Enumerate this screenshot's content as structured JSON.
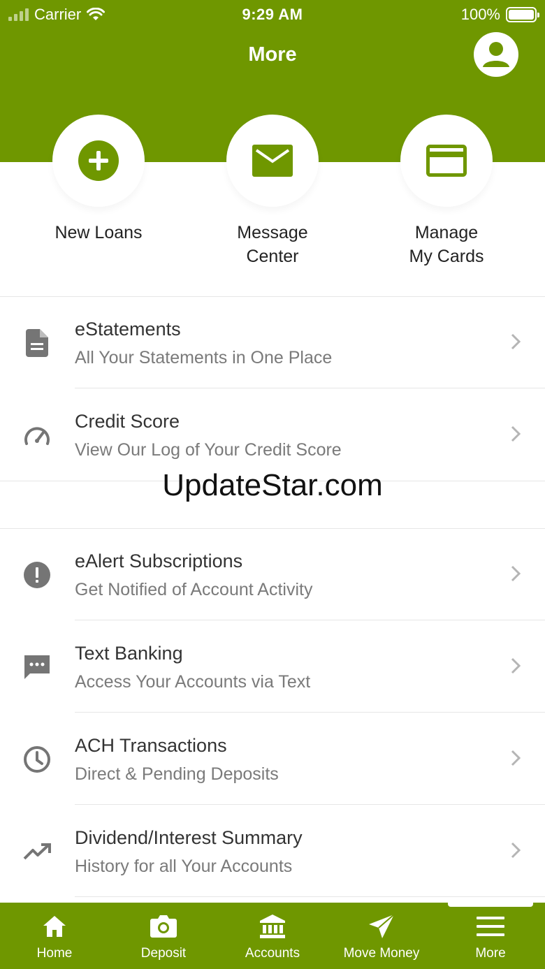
{
  "status_bar": {
    "carrier": "Carrier",
    "time": "9:29 AM",
    "battery": "100%"
  },
  "header": {
    "title": "More"
  },
  "quick_actions": [
    {
      "label": "New Loans"
    },
    {
      "label": "Message\nCenter"
    },
    {
      "label": "Manage\nMy Cards"
    }
  ],
  "menu": [
    {
      "title": "eStatements",
      "subtitle": "All Your Statements in One Place"
    },
    {
      "title": "Credit Score",
      "subtitle": "View Our Log of Your Credit Score"
    },
    {
      "title": "eAlert Subscriptions",
      "subtitle": "Get Notified of Account Activity"
    },
    {
      "title": "Text Banking",
      "subtitle": "Access Your Accounts via Text"
    },
    {
      "title": "ACH Transactions",
      "subtitle": "Direct & Pending Deposits"
    },
    {
      "title": "Dividend/Interest Summary",
      "subtitle": "History for all Your Accounts"
    }
  ],
  "watermark": "UpdateStar.com",
  "tabs": [
    {
      "label": "Home"
    },
    {
      "label": "Deposit"
    },
    {
      "label": "Accounts"
    },
    {
      "label": "Move Money"
    },
    {
      "label": "More"
    }
  ],
  "colors": {
    "brand": "#6f9700",
    "icon_grey": "#757575"
  }
}
